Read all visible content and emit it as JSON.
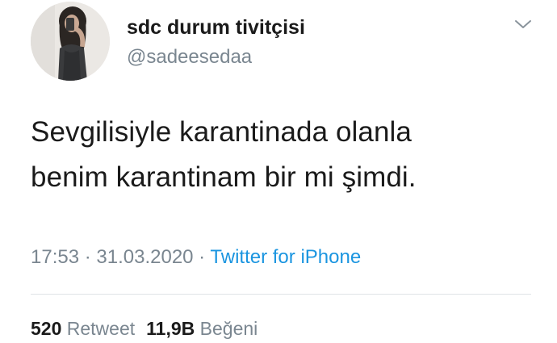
{
  "author": {
    "display_name": "sdc durum tivitçisi",
    "handle": "@sadeesedaa",
    "avatar_icon": "profile-photo"
  },
  "menu_icon": "chevron-down-icon",
  "tweet": {
    "lines": [
      "Sevgilisiyle karantinada olanla",
      "benim karantinam bir mi şimdi."
    ]
  },
  "meta": {
    "time": "17:53",
    "sep1": " · ",
    "date": "31.03.2020",
    "sep2": " · ",
    "source": "Twitter for iPhone"
  },
  "stats": {
    "retweets_count": "520",
    "retweets_label": "Retweet",
    "likes_count": "11,9B",
    "likes_label": "Beğeni"
  },
  "colors": {
    "text": "#1a1a1a",
    "muted": "#7a8690",
    "link": "#1b95e0",
    "divider": "#dfe3e6"
  }
}
